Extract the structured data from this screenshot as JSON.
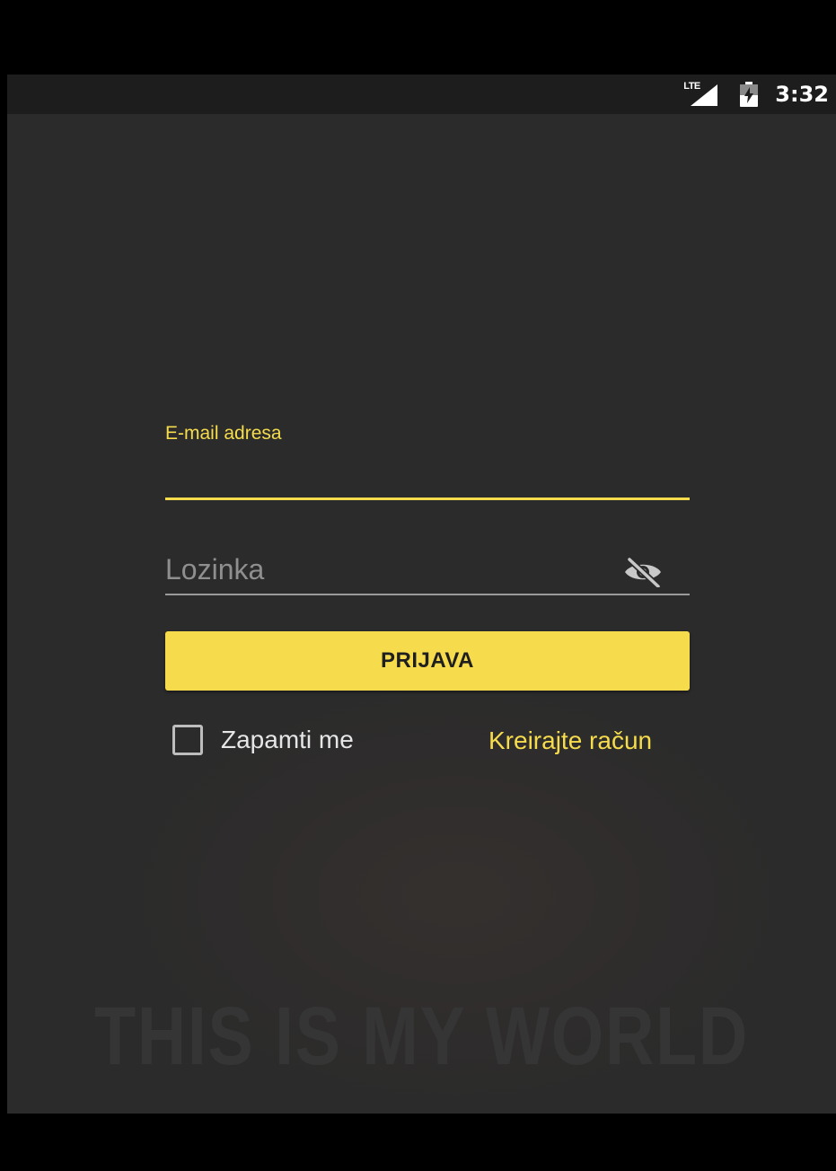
{
  "status_bar": {
    "network_label": "LTE",
    "time": "3:32",
    "signal_icon": "signal-icon",
    "battery_icon": "battery-charging-icon"
  },
  "login_form": {
    "email_label": "E-mail adresa",
    "email_value": "",
    "password_placeholder": "Lozinka",
    "password_toggle_icon": "eye-off-icon",
    "login_button_label": "PRIJAVA",
    "remember_me_label": "Zapamti me",
    "remember_me_checked": false,
    "create_account_label": "Kreirajte račun"
  },
  "background": {
    "watermark_text": "THIS IS MY WORLD"
  },
  "colors": {
    "accent": "#f6dc4c",
    "background": "#2b2b2b",
    "status_bar": "#1d1d1d"
  }
}
